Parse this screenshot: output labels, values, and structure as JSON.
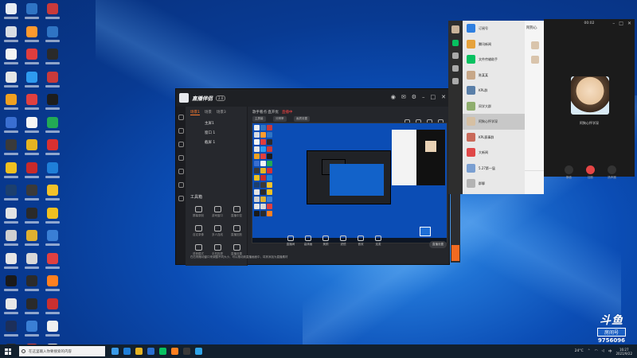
{
  "desktop": {
    "icon_colors": [
      "#e8edf3",
      "#2f74c4",
      "#c93a3a",
      "#d8dde4",
      "#ff9a2e",
      "#2f74c4",
      "#f4f4f4",
      "#e03d3d",
      "#2a2a2a",
      "#e6e6e6",
      "#2e9bf0",
      "#c93a3a",
      "#f0a020",
      "#e04040",
      "#1d1d1d",
      "#3a6fd1",
      "#f5f5f5",
      "#22aa55",
      "#3a3a3a",
      "#e6b422",
      "#d93030",
      "#f0c020",
      "#c92a2a",
      "#1f7fd8",
      "#1c3f6e",
      "#3a3a3a",
      "#f3c22a",
      "#e4e4e4",
      "#2a2a2a",
      "#f0c020",
      "#d0d0d0",
      "#e0b030",
      "#3a7fd5",
      "#e6e6e6",
      "#d8d8d8",
      "#e04040",
      "#1a1a1a",
      "#2b2b2b",
      "#ff8020",
      "#e8e8e8",
      "#2a2a2a",
      "#c93030",
      "#1c2f5a",
      "#3a7fd5",
      "#f0f0f0",
      "#2b2b2b",
      "#e04040",
      "#e8e8e8"
    ]
  },
  "app": {
    "title": "直播伴侣",
    "badge": "2.0",
    "tabs": [
      "场景1",
      "场景",
      "场景3"
    ],
    "scenes": [
      "主屏1",
      "窗口 1",
      "截屏 1"
    ],
    "tools_title": "工具箱",
    "tools": [
      "屏幕录制",
      "游戏窗口",
      "直播中控",
      "自定录像",
      "多人连线",
      "直播回放",
      "语音模式",
      "手机投屏",
      "直播设置"
    ],
    "preview_title": "歌手看点·直开优",
    "preview_title_red": "直播中",
    "chips": [
      "主屏幕",
      "分辨率",
      "画质设置"
    ],
    "bottom_tools": [
      "直播间",
      "高清画",
      "美颜",
      "滤镜",
      "音效",
      "连麦"
    ],
    "settings_btn": "直播设置",
    "notice": "在右侧拖动窗口来调整不同大小，可以拖动到直播画面中，将其添加为直播素材"
  },
  "wechat": {
    "items": [
      {
        "name": "订阅号",
        "msg": "",
        "color": "#2f7fe0"
      },
      {
        "name": "腾讯新闻",
        "msg": "",
        "color": "#e6a23c"
      },
      {
        "name": "文件传输助手",
        "msg": "",
        "color": "#07c160"
      },
      {
        "name": "陈某某",
        "msg": "",
        "color": "#c7a788"
      },
      {
        "name": "KPL群",
        "msg": "",
        "color": "#5a7fa8"
      },
      {
        "name": "同学大群",
        "msg": "",
        "color": "#8fae6e"
      },
      {
        "name": "阿狗心怀学深",
        "msg": "",
        "color": "#d6c0a3"
      },
      {
        "name": "KPL赛事群",
        "msg": "",
        "color": "#c96a5a"
      },
      {
        "name": "大新闻",
        "msg": "",
        "color": "#e04848"
      },
      {
        "name": "5.27第一届",
        "msg": "",
        "color": "#7a9fd1"
      },
      {
        "name": "群聊",
        "msg": "",
        "color": "#b3b3b3"
      }
    ],
    "chat_header": "阿狗心"
  },
  "call": {
    "time": "00:02",
    "name": "阿狗心怀学深",
    "buttons": [
      "静音",
      "挂断",
      "扬声器"
    ]
  },
  "watermark": {
    "logo": "斗鱼",
    "room_label": "房间号",
    "room_number": "9756096"
  },
  "taskbar": {
    "search_placeholder": "在这里输入你要搜索的内容",
    "app_colors": [
      "#3a9be8",
      "#1f7fd8",
      "#e6b422",
      "#2a6fd1",
      "#07c160",
      "#ff8020",
      "#3a3a3a",
      "#2ea4e8"
    ],
    "temp": "24°C",
    "time": "16:27",
    "date": "2021/9/22"
  }
}
